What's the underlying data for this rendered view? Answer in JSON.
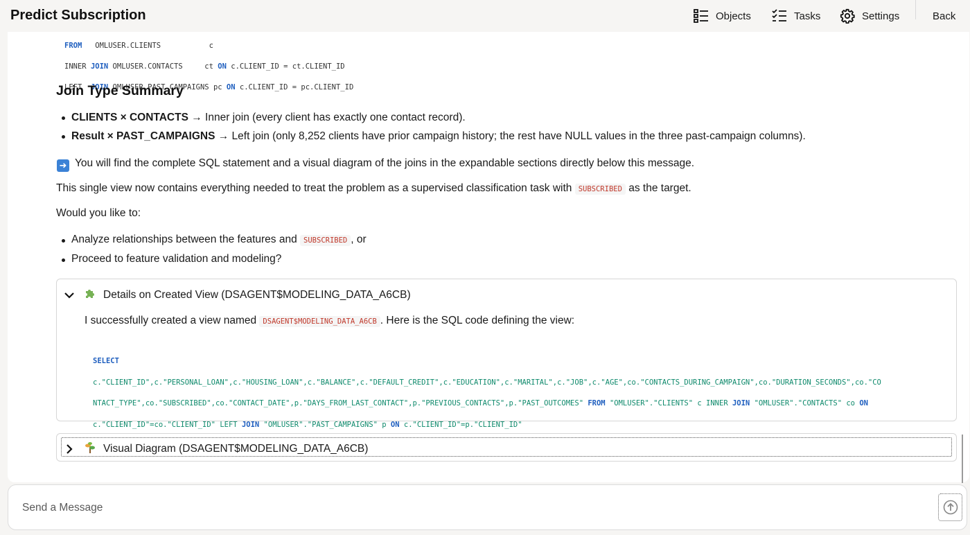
{
  "header": {
    "title": "Predict Subscription",
    "nav": {
      "objects": "Objects",
      "tasks": "Tasks",
      "settings": "Settings",
      "back": "Back"
    }
  },
  "sql_snippet": {
    "line1": {
      "kw": "FROM",
      "rest": "   OMLUSER.CLIENTS           c"
    },
    "line2": {
      "pre": "INNER ",
      "kw": "JOIN",
      "mid": " OMLUSER.CONTACTS     ct ",
      "kw_on": "ON",
      "rest": " c.CLIENT_ID = ct.CLIENT_ID"
    },
    "line3": {
      "pre": "LEFT  ",
      "kw": "JOIN",
      "mid": " OMLUSER.PAST_CAMPAIGNS pc ",
      "kw_on": "ON",
      "rest": " c.CLIENT_ID = pc.CLIENT_ID"
    }
  },
  "content": {
    "heading": "Join Type Summary",
    "bullet1_bold": "CLIENTS × CONTACTS",
    "bullet1_text": " → Inner join (every client has exactly one contact record).",
    "bullet2_bold": "Result × PAST_CAMPAIGNS",
    "bullet2_text": " → Left join (only 8,252 clients have prior campaign history; the rest have NULL values in the three past-campaign columns).",
    "arrow_text": "You will find the complete SQL statement and a visual diagram of the joins in the expandable sections directly below this message.",
    "para2_a": "This single view now contains everything needed to treat the problem as a supervised classification task with ",
    "para2_code": "SUBSCRIBED",
    "para2_b": " as the target.",
    "question": "Would you like to:",
    "opt1_a": "Analyze relationships between the features and ",
    "opt1_code": "SUBSCRIBED",
    "opt1_b": ", or",
    "opt2": "Proceed to feature validation and modeling?"
  },
  "details_panel": {
    "title": "Details on Created View (DSAGENT$MODELING_DATA_A6CB)",
    "intro_a": "I successfully created a view named ",
    "intro_code": "DSAGENT$MODELING_DATA_A6CB",
    "intro_b": ". Here is the SQL code defining the view:",
    "kw_select": "SELECT",
    "l2": "c.\"CLIENT_ID\",c.\"PERSONAL_LOAN\",c.\"HOUSING_LOAN\",c.\"BALANCE\",c.\"DEFAULT_CREDIT\",c.\"EDUCATION\",c.\"MARITAL\",c.\"JOB\",c.\"AGE\",co.\"CONTACTS_DURING_CAMPAIGN\",co.\"DURATION_SECONDS\",co.\"CO",
    "l3a": "NTACT_TYPE\",co.\"SUBSCRIBED\",co.\"CONTACT_DATE\",p.\"DAYS_FROM_LAST_CONTACT\",p.\"PREVIOUS_CONTACTS\",p.\"PAST_OUTCOMES\" ",
    "kw_from": "FROM",
    "l3b": " \"OMLUSER\".\"CLIENTS\" c INNER ",
    "kw_join1": "JOIN",
    "l3c": " \"OMLUSER\".\"CONTACTS\" co ",
    "kw_on1": "ON",
    "l4a": "c.\"CLIENT_ID\"=co.\"CLIENT_ID\" LEFT ",
    "kw_join2": "JOIN",
    "l4b": " \"OMLUSER\".\"PAST_CAMPAIGNS\" p ",
    "kw_on2": "ON",
    "l4c": " c.\"CLIENT_ID\"=p.\"CLIENT_ID\""
  },
  "diagram_panel": {
    "title": "Visual Diagram (DSAGENT$MODELING_DATA_A6CB)"
  },
  "composer": {
    "placeholder": "Send a Message"
  },
  "colors": {
    "keyword": "#1f5fbf",
    "string": "#0f8a6c",
    "inline_code": "#c0392b",
    "arrow_badge": "#3b82d6"
  }
}
